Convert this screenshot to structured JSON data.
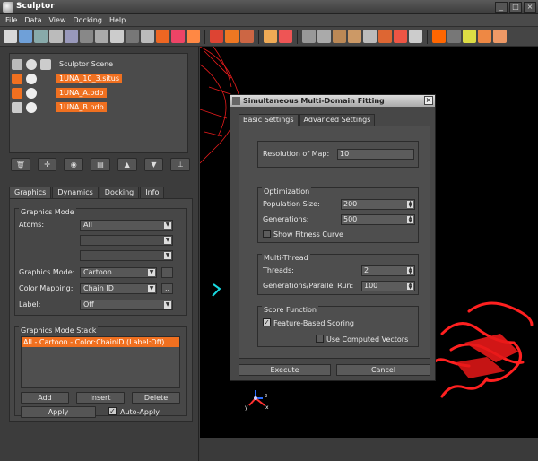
{
  "app": {
    "title": "Sculptor"
  },
  "menu": [
    "File",
    "Data",
    "View",
    "Docking",
    "Help"
  ],
  "scene": {
    "root": "Sculptor Scene",
    "items": [
      {
        "label": "1UNA_10_3.situs",
        "selected": true
      },
      {
        "label": "1UNA_A.pdb",
        "selected": true
      },
      {
        "label": "1UNA_B.pdb",
        "selected": true
      }
    ]
  },
  "left_tabs": [
    "Graphics",
    "Dynamics",
    "Docking",
    "Info"
  ],
  "graphics": {
    "mode_group": "Graphics Mode",
    "atoms_label": "Atoms:",
    "atoms_value": "All",
    "graphics_mode_label": "Graphics Mode:",
    "graphics_mode_value": "Cartoon",
    "color_mapping_label": "Color Mapping:",
    "color_mapping_value": "Chain ID",
    "label_label": "Label:",
    "label_value": "Off",
    "more_btn": "..",
    "stack_group": "Graphics Mode Stack",
    "stack_item": "All - Cartoon - Color:ChainID (Label:Off)",
    "add": "Add",
    "insert": "Insert",
    "delete": "Delete",
    "apply": "Apply",
    "auto_apply": "Auto-Apply"
  },
  "dialog": {
    "title": "Simultaneous Multi-Domain Fitting",
    "tabs": [
      "Basic Settings",
      "Advanced Settings"
    ],
    "resolution_label": "Resolution of Map:",
    "resolution_value": "10",
    "optimization_group": "Optimization",
    "population_label": "Population Size:",
    "population_value": "200",
    "generations_label": "Generations:",
    "generations_value": "500",
    "fitness_curve": "Show Fitness Curve",
    "multithread_group": "Multi-Thread",
    "threads_label": "Threads:",
    "threads_value": "2",
    "gen_parallel_label": "Generations/Parallel Run:",
    "gen_parallel_value": "100",
    "score_group": "Score Function",
    "feature_scoring": "Feature-Based Scoring",
    "computed_vectors": "Use Computed Vectors",
    "execute": "Execute",
    "cancel": "Cancel"
  },
  "axes": {
    "x": "x",
    "y": "y",
    "z": "z"
  },
  "colors": {
    "accent": "#f07020",
    "protein": "#ff2020"
  }
}
